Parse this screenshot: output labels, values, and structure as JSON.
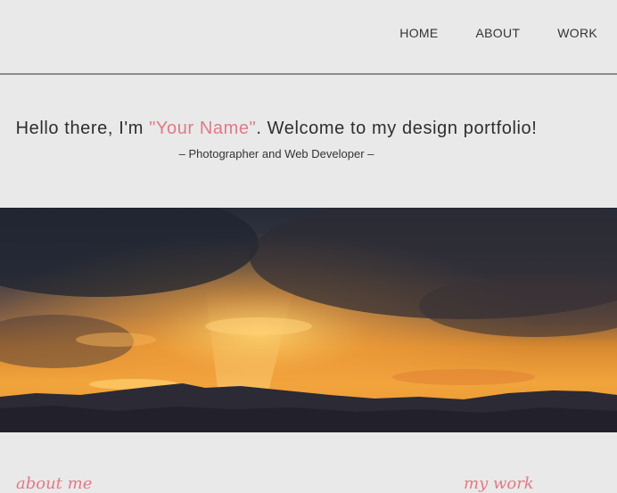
{
  "nav": {
    "items": [
      "HOME",
      "ABOUT",
      "WORK"
    ]
  },
  "hero": {
    "greeting_prefix": "Hello there, I'm ",
    "name": "\"Your Name\"",
    "greeting_suffix": ". Welcome to my design portfolio!",
    "tagline": "– Photographer and Web Developer –"
  },
  "banner": {
    "image": "sunset-mountains-photo"
  },
  "sections": {
    "about_heading": "about me",
    "work_heading": "my work"
  },
  "colors": {
    "accent": "#e07a86",
    "background": "#e9e9e9",
    "text": "#333333"
  }
}
